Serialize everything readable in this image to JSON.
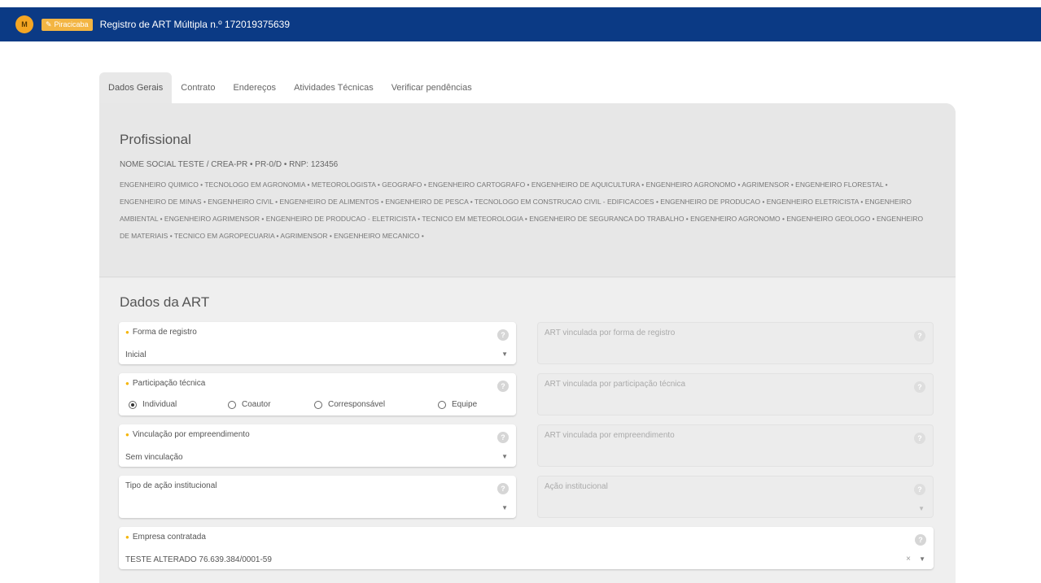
{
  "header": {
    "logo_text": "M",
    "badge_label": "Piracicaba",
    "title": "Registro de ART Múltipla n.º 172019375639"
  },
  "tabs": [
    {
      "label": "Dados Gerais"
    },
    {
      "label": "Contrato"
    },
    {
      "label": "Endereços"
    },
    {
      "label": "Atividades Técnicas"
    },
    {
      "label": "Verificar pendências"
    }
  ],
  "profissional": {
    "heading": "Profissional",
    "name_line": "NOME SOCIAL TESTE / CREA-PR • PR-0/D • RNP: 123456",
    "titles": "ENGENHEIRO QUIMICO • TECNOLOGO EM AGRONOMIA • METEOROLOGISTA • GEOGRAFO • ENGENHEIRO CARTOGRAFO • ENGENHEIRO DE AQUICULTURA • ENGENHEIRO AGRONOMO • AGRIMENSOR • ENGENHEIRO FLORESTAL • ENGENHEIRO DE MINAS • ENGENHEIRO CIVIL • ENGENHEIRO DE ALIMENTOS • ENGENHEIRO DE PESCA • TECNOLOGO EM CONSTRUCAO CIVIL - EDIFICACOES • ENGENHEIRO DE PRODUCAO • ENGENHEIRO ELETRICISTA • ENGENHEIRO AMBIENTAL • ENGENHEIRO AGRIMENSOR • ENGENHEIRO DE PRODUCAO - ELETRICISTA • TECNICO EM METEOROLOGIA • ENGENHEIRO DE SEGURANCA DO TRABALHO • ENGENHEIRO AGRONOMO • ENGENHEIRO GEOLOGO • ENGENHEIRO DE MATERIAIS • TECNICO EM AGROPECUARIA • AGRIMENSOR • ENGENHEIRO MECANICO •"
  },
  "art": {
    "heading": "Dados da ART",
    "forma_registro": {
      "label": "Forma de registro",
      "value": "Inicial"
    },
    "art_vinc_forma": {
      "label": "ART vinculada por forma de registro"
    },
    "participacao": {
      "label": "Participação técnica",
      "options": [
        "Individual",
        "Coautor",
        "Corresponsável",
        "Equipe"
      ],
      "selected": "Individual"
    },
    "art_vinc_part": {
      "label": "ART vinculada por participação técnica"
    },
    "vinculacao": {
      "label": "Vinculação por empreendimento",
      "value": "Sem vinculação"
    },
    "art_vinc_emp": {
      "label": "ART vinculada por empreendimento"
    },
    "tipo_acao": {
      "label": "Tipo de ação institucional",
      "value": ""
    },
    "acao_inst": {
      "label": "Ação institucional"
    },
    "empresa": {
      "label": "Empresa contratada",
      "value": "TESTE ALTERADO 76.639.384/0001-59"
    }
  },
  "icons": {
    "help": "?",
    "caret": "▼",
    "clear": "×"
  },
  "colors": {
    "header_bg": "#0b3a85",
    "badge_bg": "#f3b543",
    "required_mark": "#f5b400"
  }
}
